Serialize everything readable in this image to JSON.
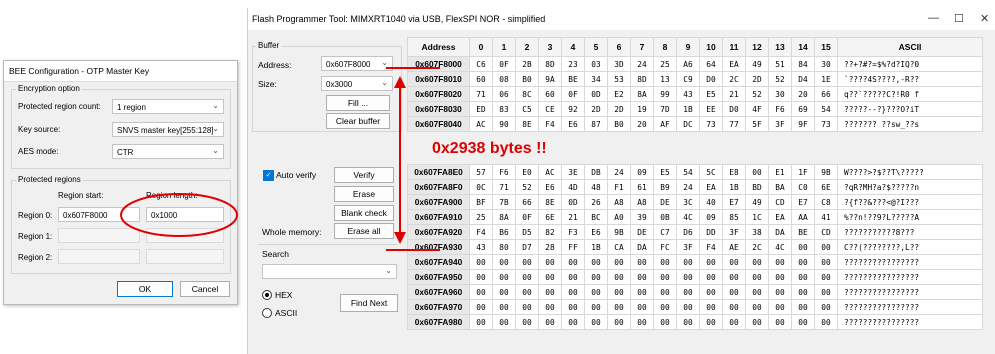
{
  "bee_dialog": {
    "title": "BEE Configuration - OTP Master Key",
    "encryption_option": {
      "group_title": "Encryption option",
      "protected_region_count_label": "Protected region count:",
      "protected_region_count_value": "1 region",
      "key_source_label": "Key source:",
      "key_source_value": "SNVS master key[255:128]",
      "aes_mode_label": "AES mode:",
      "aes_mode_value": "CTR"
    },
    "protected_regions": {
      "group_title": "Protected regions",
      "region_start_header": "Region start:",
      "region_length_header": "Region length:",
      "regions": [
        {
          "label": "Region 0:",
          "start": "0x607F8000",
          "length": "0x1000"
        },
        {
          "label": "Region 1:",
          "start": "",
          "length": ""
        },
        {
          "label": "Region 2:",
          "start": "",
          "length": ""
        }
      ]
    },
    "ok_label": "OK",
    "cancel_label": "Cancel"
  },
  "flash_tool": {
    "title": "Flash Programmer Tool:   MIMXRT1040 via USB,   FlexSPI NOR - simplified",
    "minimize": "—",
    "maximize": "☐",
    "close": "✕",
    "buffer": {
      "group_title": "Buffer",
      "address_label": "Address:",
      "address_value": "0x607F8000",
      "size_label": "Size:",
      "size_value": "0x3000",
      "fill_label": "Fill ...",
      "clear_label": "Clear buffer"
    },
    "verify": {
      "auto_verify_label": "Auto verify",
      "verify_label": "Verify",
      "erase_label": "Erase",
      "blank_check_label": "Blank check",
      "whole_memory_label": "Whole memory:",
      "erase_all_label": "Erase all"
    },
    "search": {
      "label": "Search",
      "value": "",
      "hex_label": "HEX",
      "ascii_label": "ASCII",
      "find_next_label": "Find Next"
    },
    "grid": {
      "headers": [
        "Address",
        "0",
        "1",
        "2",
        "3",
        "4",
        "5",
        "6",
        "7",
        "8",
        "9",
        "10",
        "11",
        "12",
        "13",
        "14",
        "15",
        "ASCII"
      ],
      "top_rows": [
        {
          "addr": "0x607F8000",
          "bytes": [
            "C6",
            "0F",
            "2B",
            "8D",
            "23",
            "03",
            "3D",
            "24",
            "25",
            "A6",
            "64",
            "EA",
            "49",
            "51",
            "84",
            "30"
          ],
          "ascii": "??+?#?=$%?d?IQ?0"
        },
        {
          "addr": "0x607F8010",
          "bytes": [
            "60",
            "08",
            "B0",
            "9A",
            "BE",
            "34",
            "53",
            "8D",
            "13",
            "C9",
            "D0",
            "2C",
            "2D",
            "52",
            "D4",
            "1E"
          ],
          "ascii": "`????4S????,-R??"
        },
        {
          "addr": "0x607F8020",
          "bytes": [
            "71",
            "06",
            "8C",
            "60",
            "0F",
            "0D",
            "E2",
            "8A",
            "99",
            "43",
            "E5",
            "21",
            "52",
            "30",
            "20",
            "66"
          ],
          "ascii": "q??`?????C?!R0 f"
        },
        {
          "addr": "0x607F8030",
          "bytes": [
            "ED",
            "83",
            "C5",
            "CE",
            "92",
            "2D",
            "2D",
            "19",
            "7D",
            "1B",
            "EE",
            "D0",
            "4F",
            "F6",
            "69",
            "54"
          ],
          "ascii": "?????--?}???O?iT"
        },
        {
          "addr": "0x607F8040",
          "bytes": [
            "AC",
            "90",
            "8E",
            "F4",
            "E6",
            "87",
            "B0",
            "20",
            "AF",
            "DC",
            "73",
            "77",
            "5F",
            "3F",
            "9F",
            "73"
          ],
          "ascii": "??????? ??sw_??s"
        }
      ],
      "bottom_rows": [
        {
          "addr": "0x607FA8E0",
          "bytes": [
            "57",
            "F6",
            "E0",
            "AC",
            "3E",
            "DB",
            "24",
            "09",
            "E5",
            "54",
            "5C",
            "E8",
            "00",
            "E1",
            "1F",
            "9B"
          ],
          "ascii": "W????>?$??T\\?????"
        },
        {
          "addr": "0x607FA8F0",
          "bytes": [
            "0C",
            "71",
            "52",
            "E6",
            "4D",
            "48",
            "F1",
            "61",
            "B9",
            "24",
            "EA",
            "1B",
            "BD",
            "BA",
            "C0",
            "6E"
          ],
          "ascii": "?qR?MH?a?$?????n"
        },
        {
          "addr": "0x607FA900",
          "bytes": [
            "BF",
            "7B",
            "66",
            "8E",
            "0D",
            "26",
            "A8",
            "A8",
            "DE",
            "3C",
            "40",
            "E7",
            "49",
            "CD",
            "E7",
            "C8"
          ],
          "ascii": "?{f??&???<@?I???"
        },
        {
          "addr": "0x607FA910",
          "bytes": [
            "25",
            "8A",
            "0F",
            "6E",
            "21",
            "BC",
            "A0",
            "39",
            "0B",
            "4C",
            "09",
            "85",
            "1C",
            "EA",
            "AA",
            "41"
          ],
          "ascii": "%??n!??9?L?????A"
        },
        {
          "addr": "0x607FA920",
          "bytes": [
            "F4",
            "B6",
            "D5",
            "82",
            "F3",
            "E6",
            "9B",
            "DE",
            "C7",
            "D6",
            "DD",
            "3F",
            "38",
            "DA",
            "BE",
            "CD"
          ],
          "ascii": "???????????8???"
        },
        {
          "addr": "0x607FA930",
          "bytes": [
            "43",
            "80",
            "D7",
            "28",
            "FF",
            "1B",
            "CA",
            "DA",
            "FC",
            "3F",
            "F4",
            "AE",
            "2C",
            "4C",
            "00",
            "00"
          ],
          "ascii": "C??(????????,L??"
        },
        {
          "addr": "0x607FA940",
          "bytes": [
            "00",
            "00",
            "00",
            "00",
            "00",
            "00",
            "00",
            "00",
            "00",
            "00",
            "00",
            "00",
            "00",
            "00",
            "00",
            "00"
          ],
          "ascii": "????????????????"
        },
        {
          "addr": "0x607FA950",
          "bytes": [
            "00",
            "00",
            "00",
            "00",
            "00",
            "00",
            "00",
            "00",
            "00",
            "00",
            "00",
            "00",
            "00",
            "00",
            "00",
            "00"
          ],
          "ascii": "????????????????"
        },
        {
          "addr": "0x607FA960",
          "bytes": [
            "00",
            "00",
            "00",
            "00",
            "00",
            "00",
            "00",
            "00",
            "00",
            "00",
            "00",
            "00",
            "00",
            "00",
            "00",
            "00"
          ],
          "ascii": "????????????????"
        },
        {
          "addr": "0x607FA970",
          "bytes": [
            "00",
            "00",
            "00",
            "00",
            "00",
            "00",
            "00",
            "00",
            "00",
            "00",
            "00",
            "00",
            "00",
            "00",
            "00",
            "00"
          ],
          "ascii": "????????????????"
        },
        {
          "addr": "0x607FA980",
          "bytes": [
            "00",
            "00",
            "00",
            "00",
            "00",
            "00",
            "00",
            "00",
            "00",
            "00",
            "00",
            "00",
            "00",
            "00",
            "00",
            "00"
          ],
          "ascii": "????????????????"
        }
      ]
    }
  },
  "annotation": {
    "text": "0x2938 bytes !!",
    "color": "#e00000"
  }
}
